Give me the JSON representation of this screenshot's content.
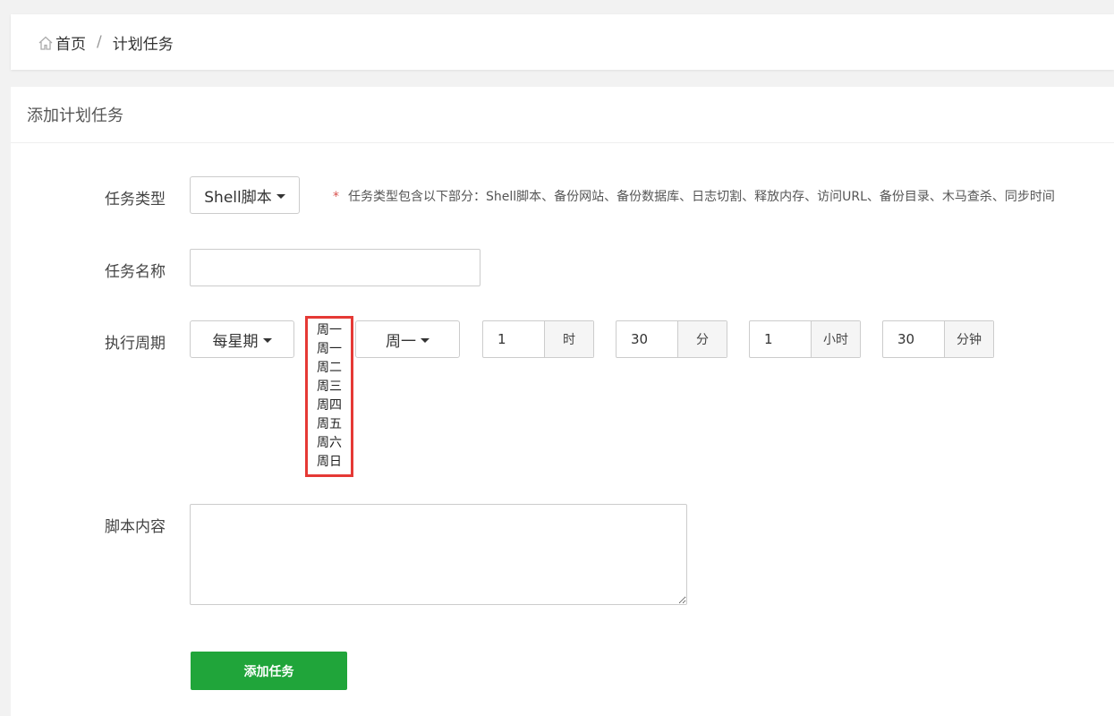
{
  "breadcrumb": {
    "home": "首页",
    "separator": "/",
    "current": "计划任务"
  },
  "panel": {
    "title": "添加计划任务"
  },
  "form": {
    "task_type": {
      "label": "任务类型",
      "value": "Shell脚本",
      "hint_star": "*",
      "hint": "任务类型包含以下部分：Shell脚本、备份网站、备份数据库、日志切割、释放内存、访问URL、备份目录、木马查杀、同步时间"
    },
    "task_name": {
      "label": "任务名称",
      "value": ""
    },
    "cycle": {
      "label": "执行周期",
      "period": "每星期",
      "weekday_options": [
        "周一",
        "周一",
        "周二",
        "周三",
        "周四",
        "周五",
        "周六",
        "周日"
      ],
      "weekday": "周一",
      "hour_value": "1",
      "hour_unit": "时",
      "minute_value": "30",
      "minute_unit": "分",
      "interval_hour_value": "1",
      "interval_hour_unit": "小时",
      "interval_minute_value": "30",
      "interval_minute_unit": "分钟"
    },
    "script": {
      "label": "脚本内容",
      "value": ""
    },
    "submit_label": "添加任务"
  },
  "colors": {
    "accent": "#20a53a",
    "highlight_border": "#e53935",
    "required": "#d9534f"
  }
}
